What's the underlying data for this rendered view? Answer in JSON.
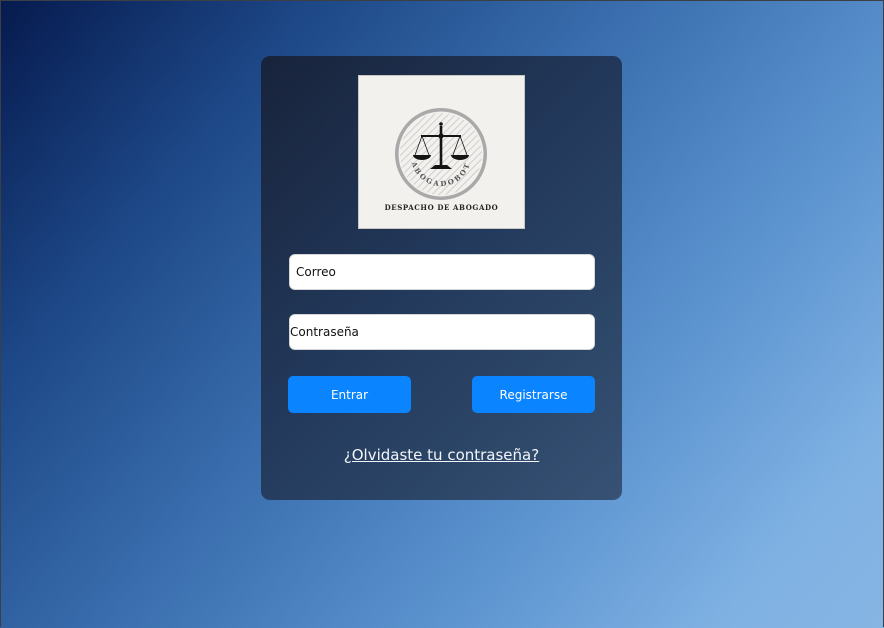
{
  "logo": {
    "brand_text": "ABOGADOBOT",
    "caption": "DESPACHO DE ABOGADO",
    "icon": "scales-of-justice-icon"
  },
  "form": {
    "email_placeholder": "Correo",
    "password_placeholder": "Contraseña",
    "login_label": "Entrar",
    "register_label": "Registrarse",
    "forgot_label": "¿Olvidaste tu contraseña?"
  },
  "colors": {
    "primary_button": "#0a84ff",
    "card_background": "#22385a",
    "input_background": "#ffffff",
    "background_dark": "#061a4e",
    "background_light": "#86b5e3"
  }
}
